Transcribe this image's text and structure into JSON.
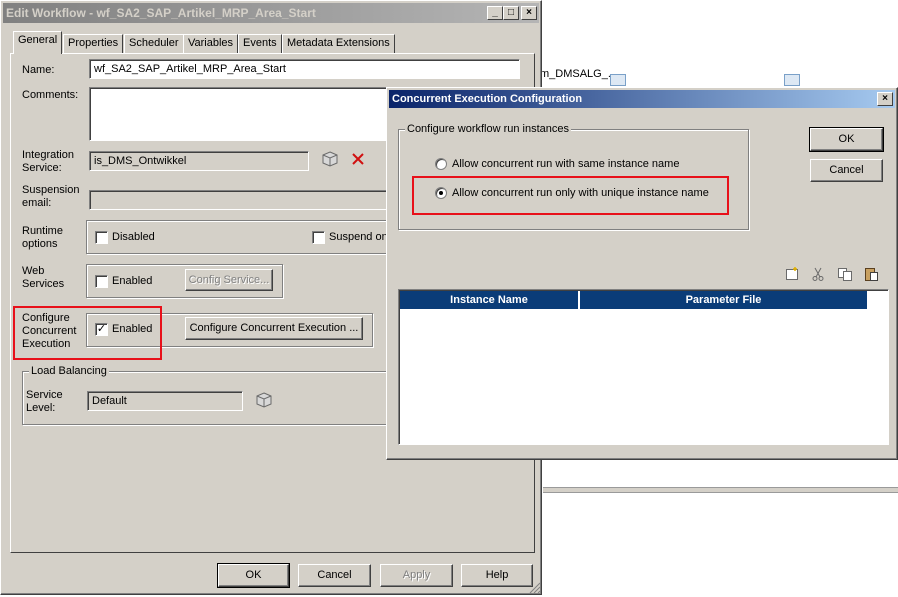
{
  "background": {
    "task_label": "m_DMSALG_."
  },
  "edit_workflow": {
    "title": "Edit Workflow - wf_SA2_SAP_Artikel_MRP_Area_Start",
    "caption_buttons": {
      "minimize": "_",
      "maximize": "□",
      "close": "×"
    },
    "tabs": [
      "General",
      "Properties",
      "Scheduler",
      "Variables",
      "Events",
      "Metadata Extensions"
    ],
    "name_label": "Name:",
    "name_value": "wf_SA2_SAP_Artikel_MRP_Area_Start",
    "comments_label": "Comments:",
    "integration_service_label": "Integration Service:",
    "integration_service_value": "is_DMS_Ontwikkel",
    "suspension_email_label": "Suspension email:",
    "runtime_options_label": "Runtime options",
    "runtime_disabled_label": "Disabled",
    "runtime_suspend_label": "Suspend on",
    "web_services_label": "Web Services",
    "web_services_enabled_label": "Enabled",
    "config_service_label": "Config Service...",
    "concurrent_label": "Configure Concurrent Execution",
    "concurrent_enabled_label": "Enabled",
    "concurrent_enabled_checked": true,
    "configure_concurrent_button": "Configure Concurrent Execution ...",
    "load_balancing_label": "Load Balancing",
    "service_level_label": "Service Level:",
    "service_level_value": "Default",
    "buttons": {
      "ok": "OK",
      "cancel": "Cancel",
      "apply": "Apply",
      "help": "Help"
    }
  },
  "concurrent_dialog": {
    "title": "Concurrent Execution Configuration",
    "close_glyph": "×",
    "group_title": "Configure workflow run instances",
    "option_same_name": "Allow concurrent run with same instance name",
    "option_unique_name": "Allow concurrent run only with unique instance name",
    "selected_option": "unique",
    "ok_label": "OK",
    "cancel_label": "Cancel",
    "table_headers": [
      "Instance Name",
      "Parameter File"
    ],
    "table_rows": [],
    "toolbar_icons": [
      "new-icon",
      "cut-icon",
      "copy-icon",
      "paste-icon"
    ]
  },
  "colors": {
    "dialog_face": "#d4d0c8",
    "active_title_start": "#0a246a",
    "active_title_end": "#a6caf0",
    "table_header": "#0a3c78",
    "highlight": "#e8101a"
  }
}
